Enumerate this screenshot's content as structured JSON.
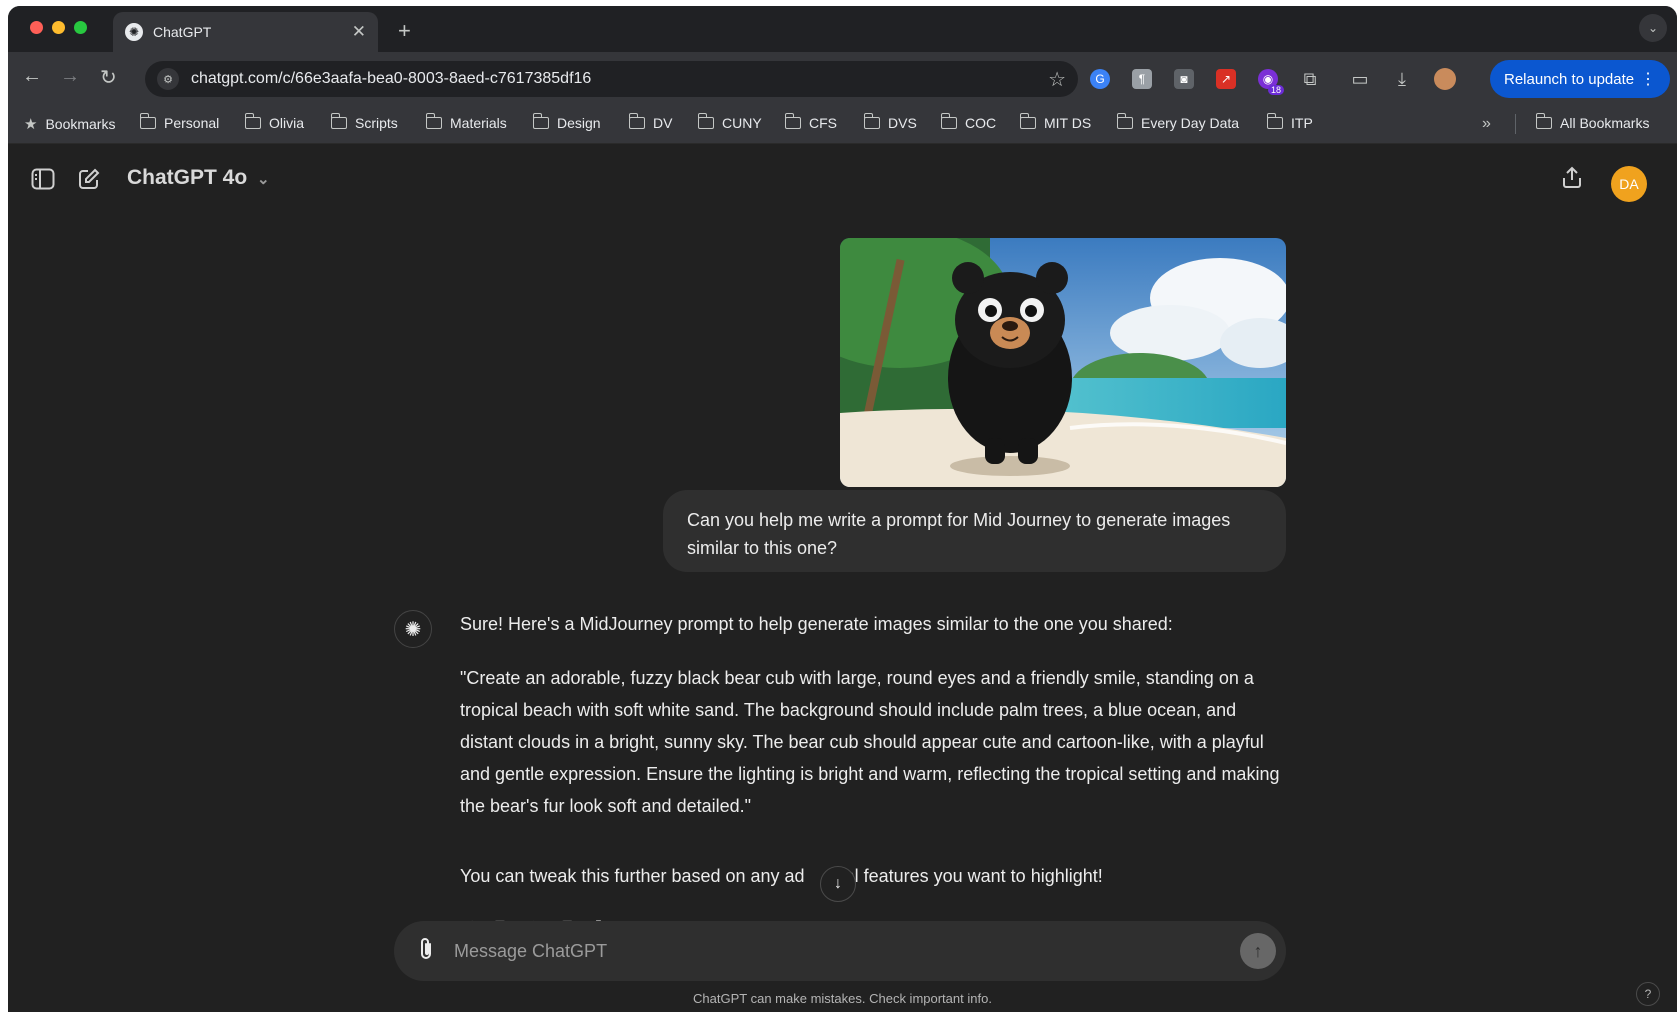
{
  "browser": {
    "tab_title": "ChatGPT",
    "url": "chatgpt.com/c/66e3aafa-bea0-8003-8aed-c7617385df16",
    "relaunch_label": "Relaunch to update",
    "extension_badge": "18",
    "bookmarks_label": "Bookmarks",
    "bookmark_folders": [
      "Personal",
      "Olivia",
      "Scripts",
      "Materials",
      "Design",
      "DV",
      "CUNY",
      "CFS",
      "DVS",
      "COC",
      "MIT DS",
      "Every Day Data",
      "ITP"
    ],
    "all_bookmarks_label": "All Bookmarks"
  },
  "app": {
    "model_name": "ChatGPT 4o",
    "avatar_initials": "DA"
  },
  "conversation": {
    "user_message": "Can you help me write a prompt for Mid Journey to generate images similar to this one?",
    "assistant_intro": "Sure! Here's a MidJourney prompt to help generate images similar to the one you shared:",
    "assistant_prompt": "\"Create an adorable, fuzzy black bear cub with large, round eyes and a friendly smile, standing on a tropical beach with soft white sand. The background should include palm trees, a blue ocean, and distant clouds in a bright, sunny sky. The bear cub should appear cute and cartoon-like, with a playful and gentle expression. Ensure the lighting is bright and warm, reflecting the tropical setting and making the bear's fur look soft and detailed.\"",
    "assistant_outro_start": "You can tweak this further based on any ad",
    "assistant_outro_end": "nal features you want to highlight!"
  },
  "composer": {
    "placeholder": "Message ChatGPT",
    "disclaimer": "ChatGPT can make mistakes. Check important info."
  },
  "help_label": "?",
  "colors": {
    "background": "#212121",
    "bubble": "#2f2f2f",
    "accent_button": "#0b57d0",
    "avatar": "#f0a21e"
  },
  "icons": [
    "sidebar-toggle-icon",
    "new-chat-icon",
    "share-icon",
    "attach-icon",
    "send-arrow-icon",
    "openai-logo-icon",
    "arrow-down-icon"
  ]
}
